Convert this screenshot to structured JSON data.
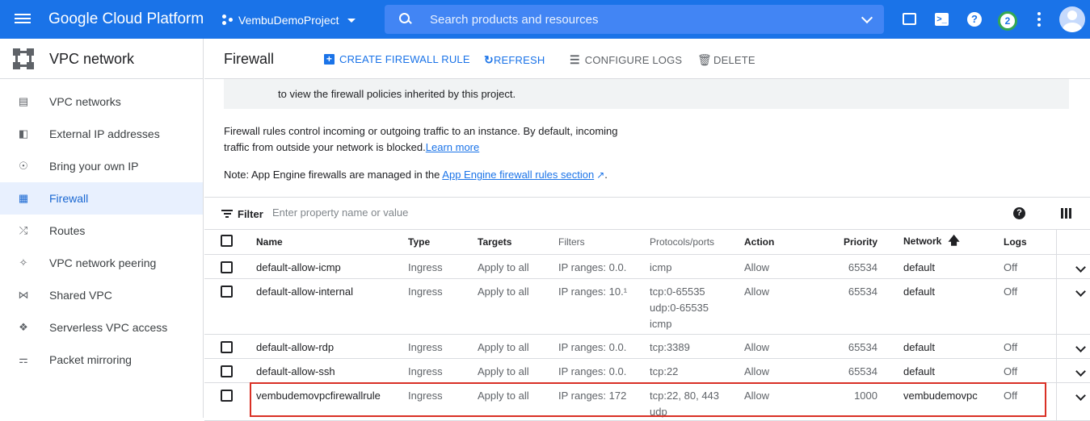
{
  "topbar": {
    "brand": "Google Cloud Platform",
    "project": "VembuDemoProject",
    "search_placeholder": "Search products and resources",
    "notification_count": "2",
    "accent_color": "#1a73e8"
  },
  "sidebar": {
    "title": "VPC network",
    "items": [
      {
        "label": "VPC networks",
        "icon": "vpc-networks-icon"
      },
      {
        "label": "External IP addresses",
        "icon": "external-ip-icon"
      },
      {
        "label": "Bring your own IP",
        "icon": "globe-icon"
      },
      {
        "label": "Firewall",
        "icon": "firewall-icon",
        "active": true
      },
      {
        "label": "Routes",
        "icon": "routes-icon"
      },
      {
        "label": "VPC network peering",
        "icon": "peering-icon"
      },
      {
        "label": "Shared VPC",
        "icon": "shared-vpc-icon"
      },
      {
        "label": "Serverless VPC access",
        "icon": "serverless-icon"
      },
      {
        "label": "Packet mirroring",
        "icon": "packet-mirroring-icon"
      }
    ]
  },
  "main": {
    "title": "Firewall",
    "actions": {
      "create": "CREATE FIREWALL RULE",
      "refresh": "REFRESH",
      "configure_logs": "CONFIGURE LOGS",
      "delete": "DELETE"
    },
    "banner_text": "to view the firewall policies inherited by this project.",
    "description_1": "Firewall rules control incoming or outgoing traffic to an instance. By default, incoming traffic from outside your network is blocked.",
    "learn_more": "Learn more",
    "note_prefix": "Note: App Engine firewalls are managed in the ",
    "note_link": "App Engine firewall rules section",
    "note_suffix": ".",
    "filter_label": "Filter",
    "filter_placeholder": "Enter property name or value"
  },
  "table": {
    "columns": {
      "name": "Name",
      "type": "Type",
      "targets": "Targets",
      "filters": "Filters",
      "protocols": "Protocols/ports",
      "action": "Action",
      "priority": "Priority",
      "network": "Network",
      "logs": "Logs"
    },
    "rows": [
      {
        "name": "default-allow-icmp",
        "type": "Ingress",
        "targets": "Apply to all",
        "filters": "IP ranges: 0.0.",
        "protocols": [
          "icmp"
        ],
        "action": "Allow",
        "priority": "65534",
        "network": "default",
        "logs": "Off"
      },
      {
        "name": "default-allow-internal",
        "type": "Ingress",
        "targets": "Apply to all",
        "filters": "IP ranges: 10.¹",
        "protocols": [
          "tcp:0-65535",
          "udp:0-65535",
          "icmp"
        ],
        "action": "Allow",
        "priority": "65534",
        "network": "default",
        "logs": "Off"
      },
      {
        "name": "default-allow-rdp",
        "type": "Ingress",
        "targets": "Apply to all",
        "filters": "IP ranges: 0.0.",
        "protocols": [
          "tcp:3389"
        ],
        "action": "Allow",
        "priority": "65534",
        "network": "default",
        "logs": "Off"
      },
      {
        "name": "default-allow-ssh",
        "type": "Ingress",
        "targets": "Apply to all",
        "filters": "IP ranges: 0.0.",
        "protocols": [
          "tcp:22"
        ],
        "action": "Allow",
        "priority": "65534",
        "network": "default",
        "logs": "Off"
      },
      {
        "name": "vembudemovpcfirewallrule",
        "type": "Ingress",
        "targets": "Apply to all",
        "filters": "IP ranges: 172",
        "protocols": [
          "tcp:22, 80, 443",
          "udp"
        ],
        "action": "Allow",
        "priority": "1000",
        "network": "vembudemovpc",
        "logs": "Off"
      }
    ]
  }
}
